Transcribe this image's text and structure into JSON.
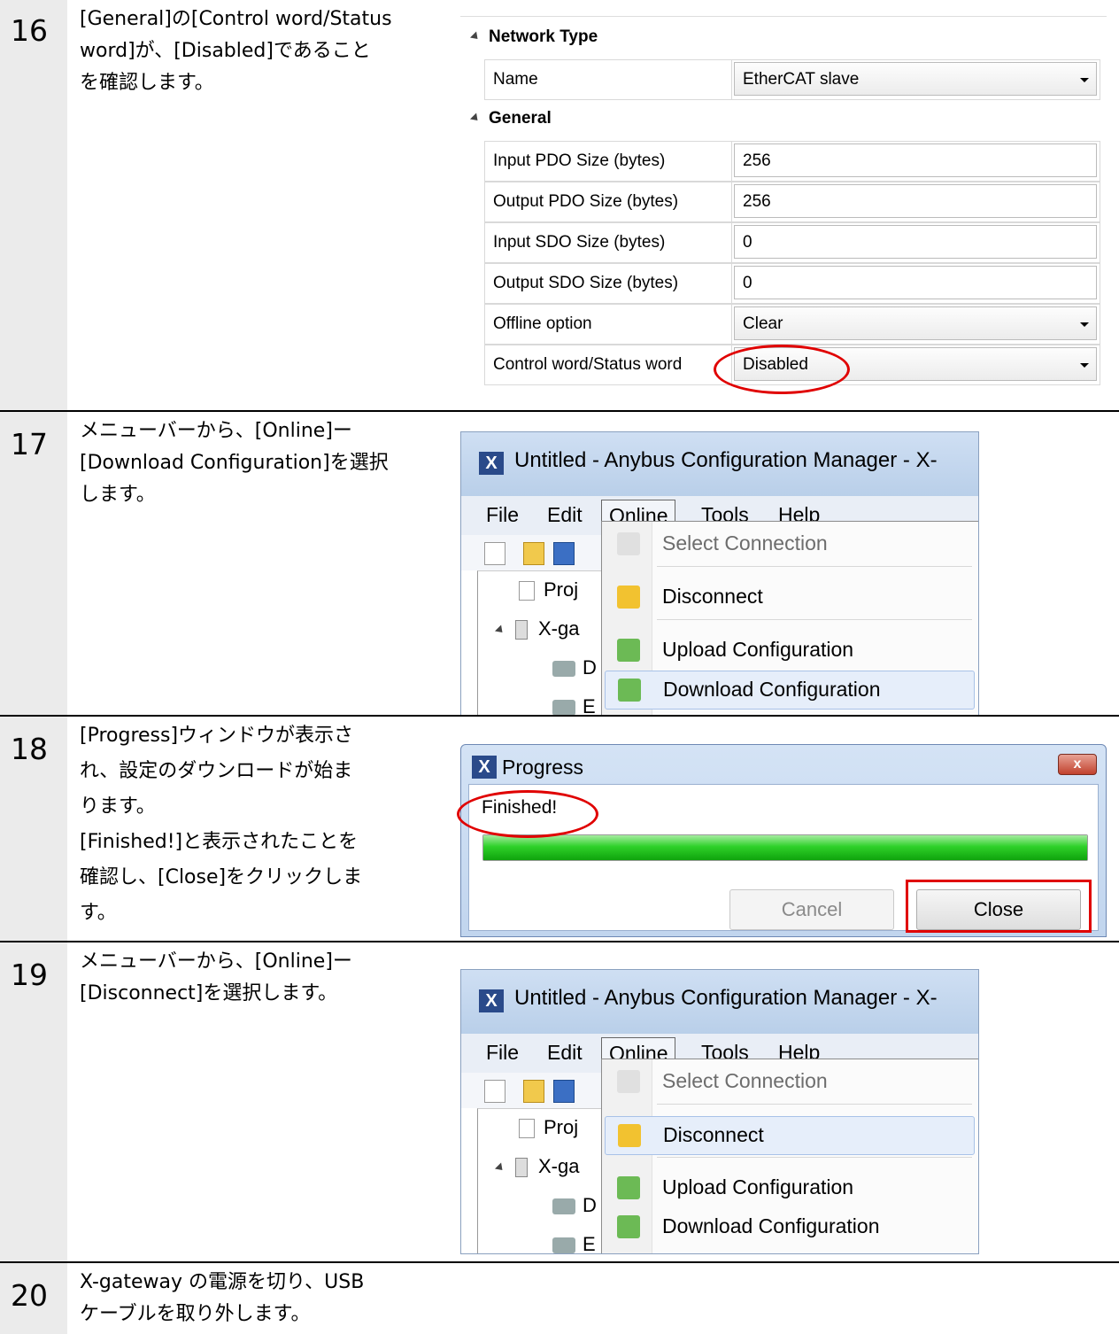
{
  "steps": [
    {
      "number": "16",
      "lines": [
        "[General]の[Control word/Status",
        "word]が、[Disabled]であること",
        "を確認します。"
      ]
    },
    {
      "number": "17",
      "lines": [
        "メニューバーから、[Online]ー",
        "[Download Configuration]を選択",
        "します。"
      ]
    },
    {
      "number": "18",
      "lines": [
        "[Progress]ウィンドウが表示さ",
        "れ、設定のダウンロードが始ま",
        "ります。",
        "[Finished!]と表示されたことを",
        "確認し、[Close]をクリックしま",
        "す。"
      ]
    },
    {
      "number": "19",
      "lines": [
        "メニューバーから、[Online]ー",
        "[Disconnect]を選択します。"
      ]
    },
    {
      "number": "20",
      "lines": [
        "X-gateway の電源を切り、USB",
        "ケーブルを取り外します。"
      ]
    }
  ],
  "property_grid": {
    "network_type_header": "Network Type",
    "general_header": "General",
    "network_rows": [
      {
        "name": "Name",
        "value": "EtherCAT slave"
      }
    ],
    "general_rows": [
      {
        "name": "Input PDO Size (bytes)",
        "value": "256"
      },
      {
        "name": "Output PDO Size (bytes)",
        "value": "256"
      },
      {
        "name": "Input SDO Size (bytes)",
        "value": "0"
      },
      {
        "name": "Output SDO Size (bytes)",
        "value": "0"
      },
      {
        "name": "Offline option",
        "value": "Clear"
      },
      {
        "name": "Control word/Status word",
        "value": "Disabled"
      }
    ]
  },
  "app_window": {
    "title": "Untitled - Anybus Configuration Manager - X-",
    "menu": [
      "File",
      "Edit",
      "Online",
      "Tools",
      "Help"
    ],
    "tree": [
      "Proj",
      "X-ga",
      "D",
      "E"
    ],
    "online_menu": [
      "Select Connection",
      "Disconnect",
      "Upload Configuration",
      "Download Configuration"
    ]
  },
  "progress_window": {
    "title": "Progress",
    "status": "Finished!",
    "progress_fraction": 1.0,
    "cancel_label": "Cancel",
    "close_label": "Close",
    "close_glyph": "x"
  }
}
